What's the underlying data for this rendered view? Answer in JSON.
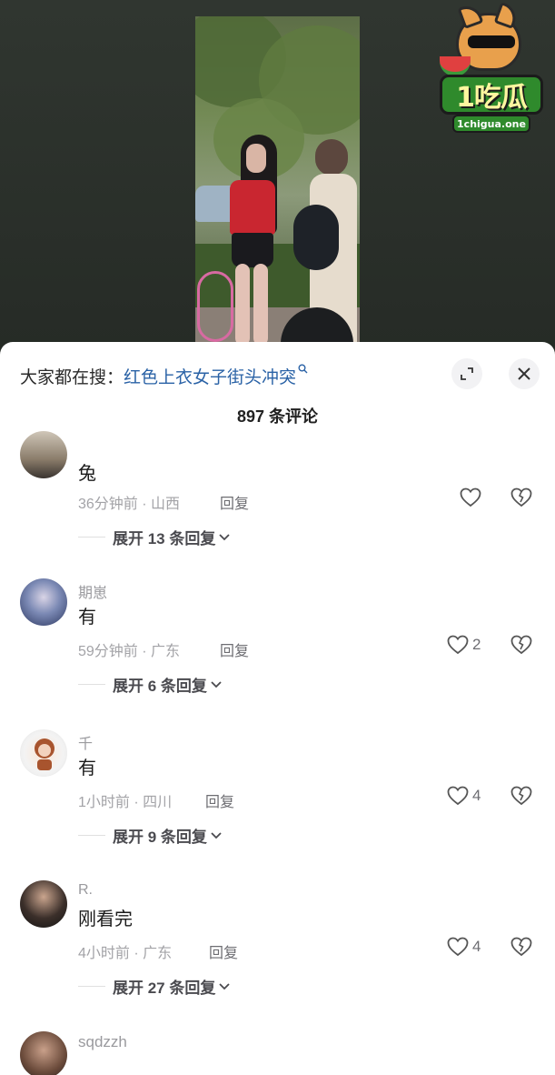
{
  "logo": {
    "text": "1吃瓜",
    "url": "1chigua.one"
  },
  "sheet": {
    "search_prefix": "大家都在搜：",
    "search_term": "红色上衣女子街头冲突",
    "title": "897 条评论"
  },
  "comments": [
    {
      "user": "",
      "text": "兔",
      "meta": "36分钟前 · 山西",
      "reply": "回复",
      "likes": "",
      "expand": "展开 13 条回复"
    },
    {
      "user": "期崽",
      "text": "有",
      "meta": "59分钟前 · 广东",
      "reply": "回复",
      "likes": "2",
      "expand": "展开 6 条回复"
    },
    {
      "user": "千",
      "text": "有",
      "meta": "1小时前 · 四川",
      "reply": "回复",
      "likes": "4",
      "expand": "展开 9 条回复"
    },
    {
      "user": "R.",
      "text": "刚看完",
      "meta": "4小时前 · 广东",
      "reply": "回复",
      "likes": "4",
      "expand": "展开 27 条回复"
    },
    {
      "user": "sqdzzh",
      "text": "",
      "meta": "",
      "reply": "",
      "likes": "",
      "expand": ""
    }
  ],
  "icons": {
    "expand": "expand-icon",
    "close": "close-icon",
    "like": "heart-icon",
    "dislike": "broken-heart-icon",
    "chevron": "chevron-down-icon"
  },
  "colors": {
    "link": "#2a62a6",
    "meta": "#a3a3a7",
    "background": "#ffffff"
  }
}
